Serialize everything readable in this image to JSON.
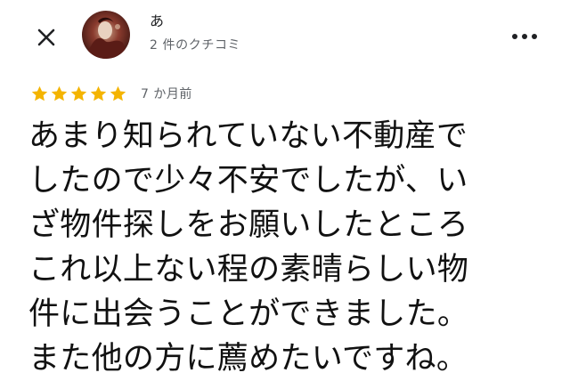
{
  "header": {
    "user_name": "あ",
    "review_count": "2 件のクチコミ"
  },
  "icons": {
    "close": "close-icon",
    "more": "more-vert-icon",
    "star": "star-icon"
  },
  "review": {
    "rating": 5,
    "rating_max": 5,
    "date": "7 か月前",
    "lines": [
      "あまり知られていない不動産で",
      "したので少々不安でしたが、い",
      "ざ物件探しをお願いしたところ",
      "これ以上ない程の素晴らしい物",
      "件に出会うことができました。",
      "また他の方に薦めたいですね。"
    ]
  },
  "colors": {
    "star": "#f4b400",
    "text_primary": "#111111",
    "text_secondary": "#5f6368"
  }
}
